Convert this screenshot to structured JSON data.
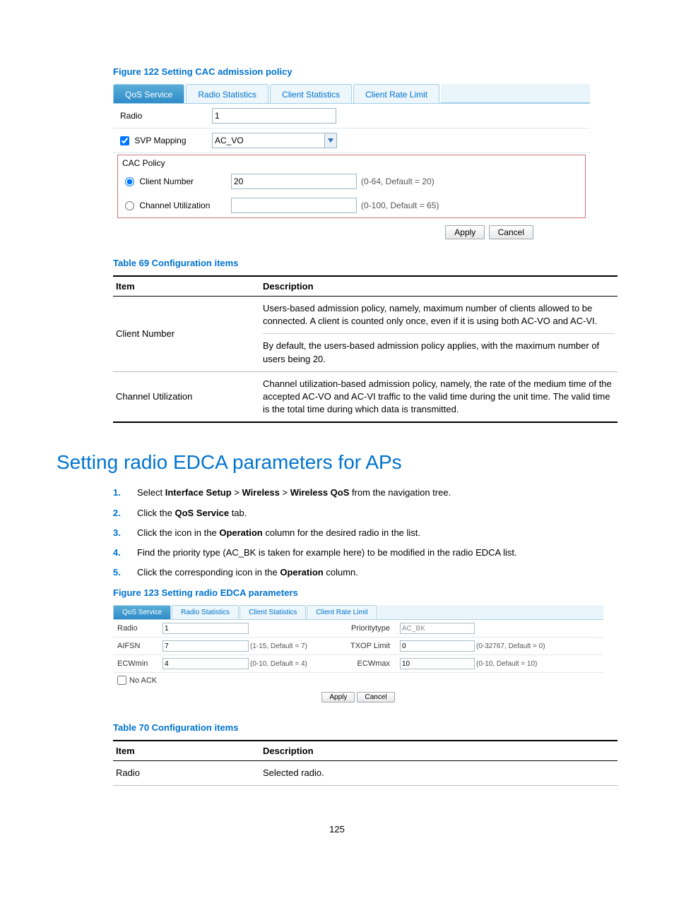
{
  "figure122": {
    "caption": "Figure 122 Setting CAC admission policy",
    "tabs": [
      "QoS Service",
      "Radio Statistics",
      "Client Statistics",
      "Client Rate Limit"
    ],
    "radio_label": "Radio",
    "radio_value": "1",
    "svp_label": "SVP Mapping",
    "svp_value": "AC_VO",
    "cac_legend": "CAC Policy",
    "client_label": "Client Number",
    "client_value": "20",
    "client_hint": "(0-64, Default = 20)",
    "chan_label": "Channel Utilization",
    "chan_value": "",
    "chan_hint": "(0-100, Default = 65)",
    "apply": "Apply",
    "cancel": "Cancel"
  },
  "table69": {
    "caption": "Table 69 Configuration items",
    "h1": "Item",
    "h2": "Description",
    "r1_item": "Client Number",
    "r1_desc_a": "Users-based admission policy, namely, maximum number of clients allowed to be connected. A client is counted only once, even if it is using both AC-VO and AC-VI.",
    "r1_desc_b": "By default, the users-based admission policy applies, with the maximum number of users being 20.",
    "r2_item": "Channel Utilization",
    "r2_desc": "Channel utilization-based admission policy, namely, the rate of the medium time of the accepted AC-VO and AC-VI traffic to the valid time during the unit time. The valid time is the total time during which data is transmitted."
  },
  "section_title": "Setting radio EDCA parameters for APs",
  "steps": {
    "s1_a": "Select ",
    "s1_b": "Interface Setup",
    "s1_c": " > ",
    "s1_d": "Wireless",
    "s1_e": " > ",
    "s1_f": "Wireless QoS",
    "s1_g": " from the navigation tree.",
    "s2_a": "Click the ",
    "s2_b": "QoS Service",
    "s2_c": " tab.",
    "s3_a": "Click the icon in the ",
    "s3_b": "Operation",
    "s3_c": " column for the desired radio in the list.",
    "s4": "Find the priority type (AC_BK is taken for example here) to be modified in the radio EDCA list.",
    "s5_a": "Click the corresponding icon in the ",
    "s5_b": "Operation",
    "s5_c": " column."
  },
  "figure123": {
    "caption": "Figure 123 Setting radio EDCA parameters",
    "tabs": [
      "QoS Service",
      "Radio Statistics",
      "Client Statistics",
      "Client Rate Limit"
    ],
    "radio_label": "Radio",
    "radio_value": "1",
    "ptype_label": "Prioritytype",
    "ptype_value": "AC_BK",
    "aifsn_label": "AIFSN",
    "aifsn_value": "7",
    "aifsn_hint": "(1-15, Default = 7)",
    "txop_label": "TXOP Limit",
    "txop_value": "0",
    "txop_hint": "(0-32767, Default = 0)",
    "ecwmin_label": "ECWmin",
    "ecwmin_value": "4",
    "ecwmin_hint": "(0-10, Default = 4)",
    "ecwmax_label": "ECWmax",
    "ecwmax_value": "10",
    "ecwmax_hint": "(0-10, Default = 10)",
    "noack_label": "No ACK",
    "apply": "Apply",
    "cancel": "Cancel"
  },
  "table70": {
    "caption": "Table 70 Configuration items",
    "h1": "Item",
    "h2": "Description",
    "r1_item": "Radio",
    "r1_desc": "Selected radio."
  },
  "pagenum": "125"
}
